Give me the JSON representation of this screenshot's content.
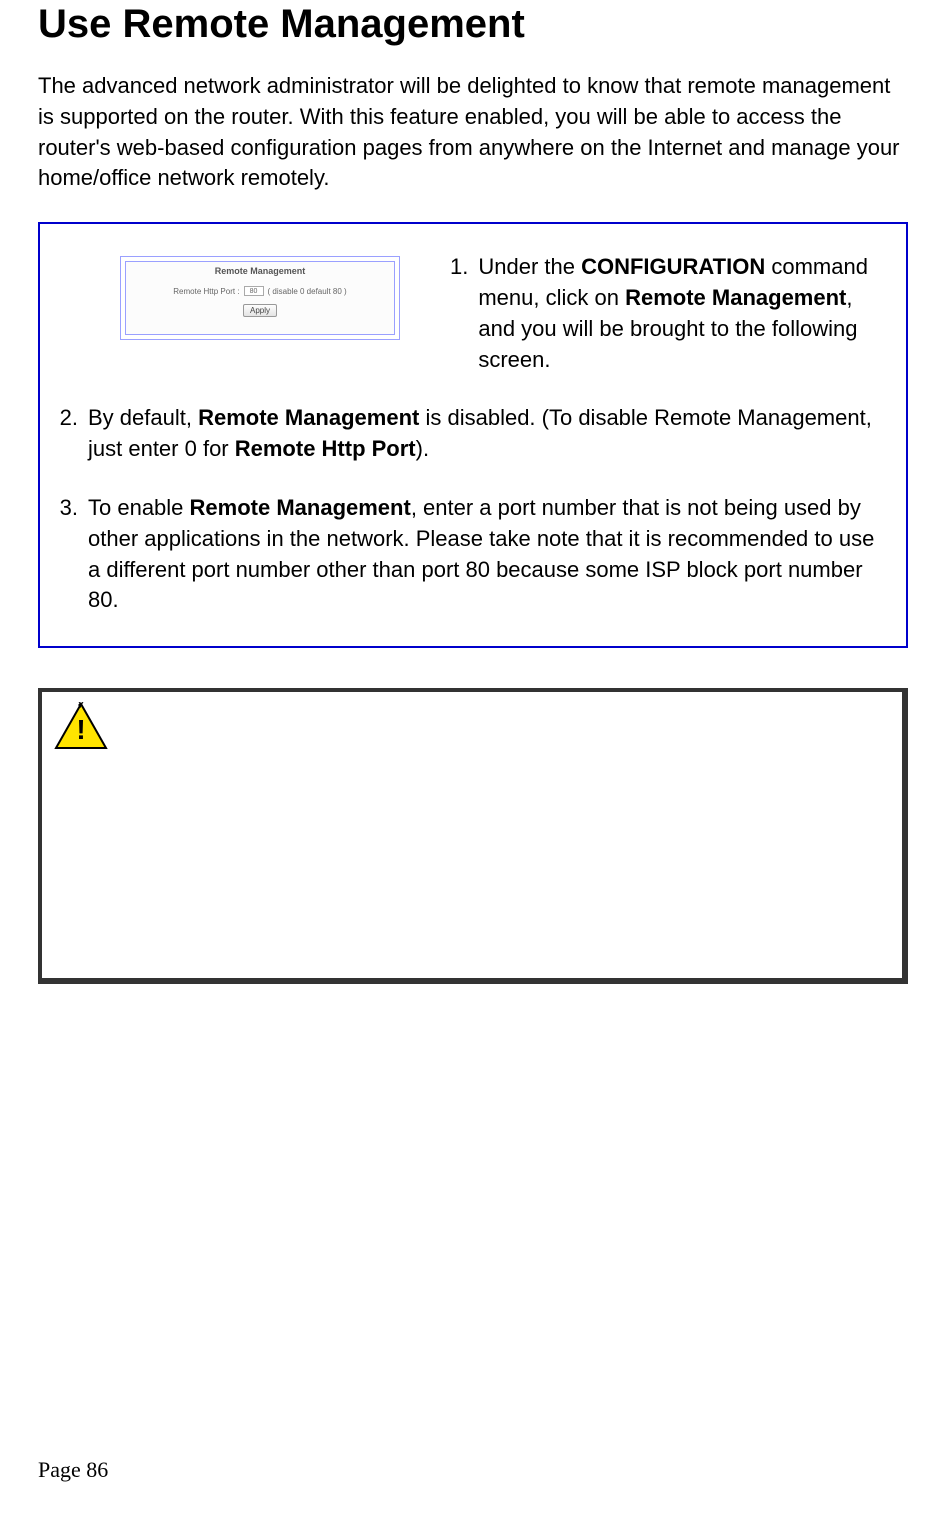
{
  "title": "Use Remote Management",
  "intro": "The advanced network administrator will be delighted to know that remote management is supported on the router. With this feature enabled, you will be able to access the router's web-based configuration pages from anywhere on the Internet and manage your home/office network remotely.",
  "thumb": {
    "heading": "Remote Management",
    "field_label": "Remote Http Port :",
    "field_value": "80",
    "field_hint": "( disable 0 default 80 )",
    "button": "Apply"
  },
  "steps": {
    "s1_marker": "1.",
    "s1_pre": "Under the ",
    "s1_bold1": "CONFIGURATION",
    "s1_mid1": " command menu, click on ",
    "s1_bold2": "Remote Management",
    "s1_post": ", and you will be brought to the following screen.",
    "s2_marker": "2.",
    "s2_pre": "By default, ",
    "s2_bold1": "Remote Management",
    "s2_mid1": " is disabled. (To disable Remote Management, just enter 0 for ",
    "s2_bold2": "Remote Http Port",
    "s2_post": ").",
    "s3_marker": "3.",
    "s3_pre": "To enable ",
    "s3_bold1": "Remote Management",
    "s3_post": ", enter a port number that is not being used by other applications in the network. Please take note that it is recommended to use a different port number other than port 80 because some ISP block port number 80."
  },
  "page_number": "Page 86"
}
